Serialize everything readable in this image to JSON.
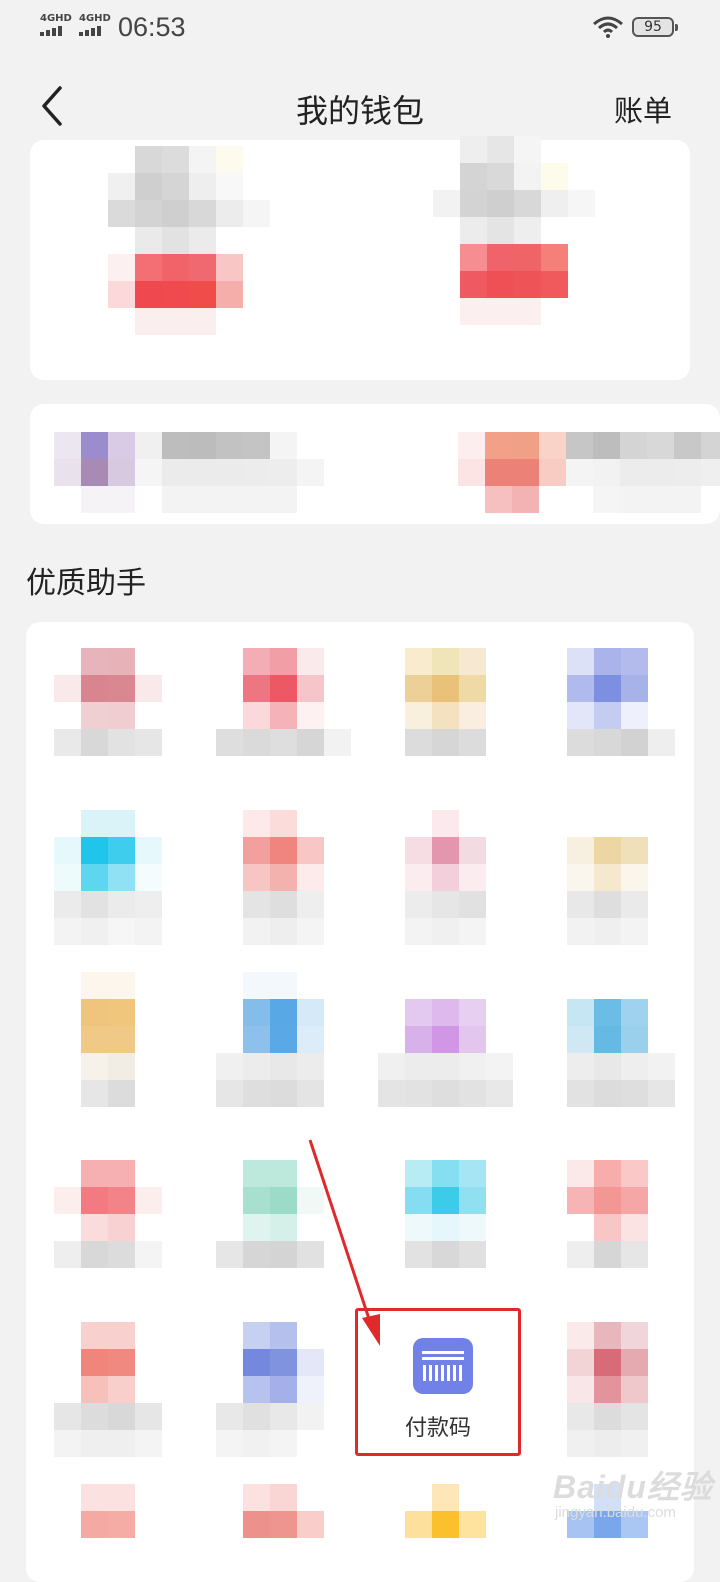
{
  "status_bar": {
    "sim1": "4GHD",
    "sim2": "4GHD",
    "time": "06:53",
    "battery": "95"
  },
  "header": {
    "title": "我的钱包",
    "bills_label": "账单"
  },
  "assistant_section": {
    "title": "优质助手",
    "highlighted_item": {
      "label": "付款码",
      "icon": "barcode-icon",
      "icon_color": "#7281e8"
    }
  },
  "annotation": {
    "highlight_color": "#e02a2a"
  },
  "watermark": {
    "brand": "Baidu经验",
    "domain": "jingyan.baidu.com"
  }
}
